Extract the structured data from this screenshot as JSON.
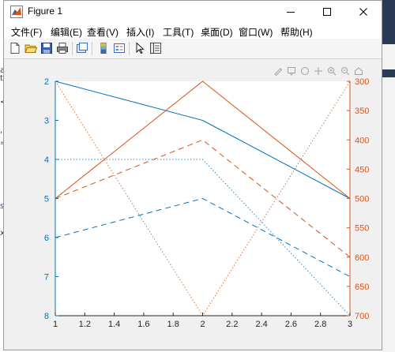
{
  "window": {
    "title": "Figure 1",
    "controls": {
      "minimize": "minimize",
      "maximize": "maximize",
      "close": "close"
    }
  },
  "menu": [
    "文件(F)",
    "编辑(E)",
    "查看(V)",
    "插入(I)",
    "工具(T)",
    "桌面(D)",
    "窗口(W)",
    "帮助(H)"
  ],
  "toolbar": [
    "new-figure-icon",
    "open-file-icon",
    "save-icon",
    "print-icon",
    "link-plot-icon",
    "colorbar-icon",
    "legend-icon",
    "pointer-icon",
    "property-editor-icon"
  ],
  "axes_toolbar": [
    "brush-icon",
    "datatip-icon",
    "rotate-icon",
    "pan-icon",
    "zoom-in-icon",
    "zoom-out-icon",
    "home-icon"
  ],
  "colors": {
    "left": "#0072bd",
    "right": "#d95319"
  },
  "chart_data": {
    "type": "line",
    "x_ticks": [
      "1",
      "1.2",
      "1.4",
      "1.6",
      "1.8",
      "2",
      "2.2",
      "2.4",
      "2.6",
      "2.8",
      "3"
    ],
    "y_left_ticks": [
      "2",
      "3",
      "4",
      "5",
      "6",
      "7",
      "8"
    ],
    "y_right_ticks": [
      "300",
      "350",
      "400",
      "450",
      "500",
      "550",
      "600",
      "650",
      "700"
    ],
    "xlim": [
      1,
      3
    ],
    "ylim_left": [
      2,
      8
    ],
    "ylim_right": [
      300,
      700
    ],
    "y_left_reversed": true,
    "y_right_reversed": true,
    "grid": false,
    "legend": "none",
    "series": [
      {
        "axis": "left",
        "style": "solid",
        "x": [
          1,
          2,
          3
        ],
        "y": [
          2,
          3,
          5
        ]
      },
      {
        "axis": "left",
        "style": "dashed",
        "x": [
          1,
          2,
          3
        ],
        "y": [
          6,
          5,
          7
        ]
      },
      {
        "axis": "left",
        "style": "dotted",
        "x": [
          1,
          2,
          3
        ],
        "y": [
          4,
          4,
          8
        ]
      },
      {
        "axis": "right",
        "style": "solid",
        "x": [
          1,
          2,
          3
        ],
        "y": [
          500,
          300,
          500
        ]
      },
      {
        "axis": "right",
        "style": "dashed",
        "x": [
          1,
          2,
          3
        ],
        "y": [
          500,
          400,
          600
        ]
      },
      {
        "axis": "right",
        "style": "dotted",
        "x": [
          1,
          2,
          3
        ],
        "y": [
          300,
          700,
          300
        ]
      }
    ]
  }
}
